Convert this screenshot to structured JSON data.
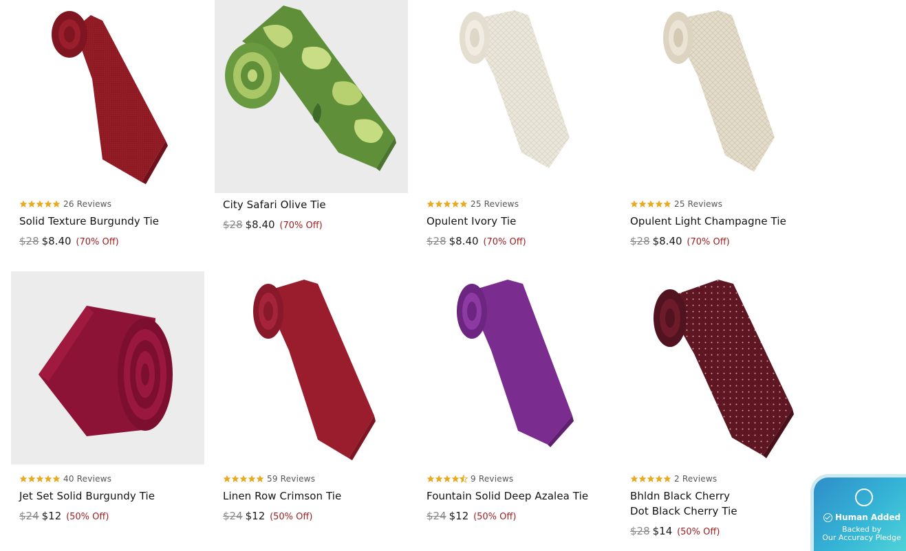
{
  "products": [
    {
      "name": "Solid Texture Burgundy Tie",
      "reviews": "26 Reviews",
      "rating": 5,
      "orig_price": "$28",
      "sale_price": "$8.40",
      "discount": "(70% Off)",
      "image": "tie-burgundy-texture",
      "color": "#8e1a24"
    },
    {
      "name": "City Safari Olive Tie",
      "reviews": "",
      "rating": 0,
      "orig_price": "$28",
      "sale_price": "$8.40",
      "discount": "(70% Off)",
      "image": "tie-camo-olive",
      "color": "#5b8a3a"
    },
    {
      "name": "Opulent Ivory Tie",
      "reviews": "25 Reviews",
      "rating": 5,
      "orig_price": "$28",
      "sale_price": "$8.40",
      "discount": "(70% Off)",
      "image": "tie-ivory-pattern",
      "color": "#ebe7dc"
    },
    {
      "name": "Opulent Light Champagne Tie",
      "reviews": "25 Reviews",
      "rating": 5,
      "orig_price": "$28",
      "sale_price": "$8.40",
      "discount": "(70% Off)",
      "image": "tie-champagne-pattern",
      "color": "#e4dccb"
    },
    {
      "name": "Jet Set Solid Burgundy Tie",
      "reviews": "40 Reviews",
      "rating": 5,
      "orig_price": "$24",
      "sale_price": "$12",
      "discount": "(50% Off)",
      "image": "tie-burgundy-rolled",
      "color": "#8c1336"
    },
    {
      "name": "Linen Row Crimson Tie",
      "reviews": "59 Reviews",
      "rating": 5,
      "orig_price": "$24",
      "sale_price": "$12",
      "discount": "(50% Off)",
      "image": "tie-crimson-linen",
      "color": "#991d2c"
    },
    {
      "name": "Fountain Solid Deep Azalea Tie",
      "reviews": "9 Reviews",
      "rating": 4.5,
      "orig_price": "$24",
      "sale_price": "$12",
      "discount": "(50% Off)",
      "image": "tie-azalea-purple",
      "color": "#7a2d8f"
    },
    {
      "name_line1": "Bhldn Black Cherry",
      "name_line2": "Dot Black Cherry Tie",
      "reviews": "2 Reviews",
      "rating": 5,
      "orig_price": "$28",
      "sale_price": "$14",
      "discount": "(50% Off)",
      "image": "tie-black-cherry-dot",
      "color": "#5e1622"
    }
  ],
  "badge": {
    "title": "Human Added",
    "line2": "Backed by",
    "line3": "Our Accuracy Pledge",
    "icon": "chat-bubble-icon",
    "check_icon": "check-circle-icon"
  },
  "colors": {
    "star": "#e8a91e",
    "discount": "#9b1c1c",
    "strike": "#888888"
  }
}
